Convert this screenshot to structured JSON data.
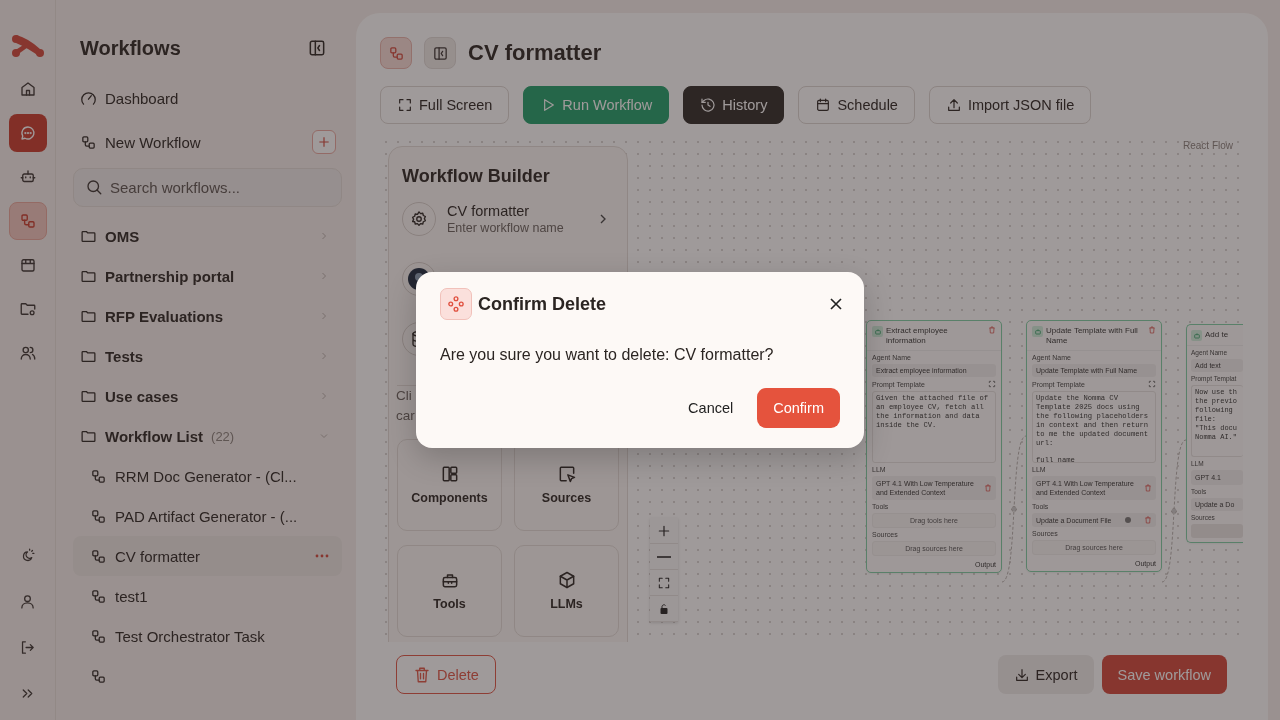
{
  "rail": [
    {
      "kind": "home",
      "selected": false,
      "accent": false
    },
    {
      "kind": "chat",
      "selected": false,
      "accent": true
    },
    {
      "kind": "bot",
      "selected": false,
      "accent": false
    },
    {
      "kind": "workflow",
      "selected": true,
      "accent": false
    },
    {
      "kind": "box",
      "selected": false,
      "accent": false
    },
    {
      "kind": "folder",
      "selected": false,
      "accent": false
    },
    {
      "kind": "users",
      "selected": false,
      "accent": false
    }
  ],
  "rail_bottom": [
    {
      "kind": "theme"
    },
    {
      "kind": "user"
    },
    {
      "kind": "logout"
    },
    {
      "kind": "expand"
    }
  ],
  "sidebar": {
    "title": "Workflows",
    "dashboard": "Dashboard",
    "new_workflow": "New Workflow",
    "search": {
      "placeholder": "Search workflows..."
    },
    "folders": [
      {
        "name": "OMS",
        "expanded": false
      },
      {
        "name": "Partnership portal",
        "expanded": false
      },
      {
        "name": "RFP Evaluations",
        "expanded": false
      },
      {
        "name": "Tests",
        "expanded": false
      },
      {
        "name": "Use cases",
        "expanded": false
      },
      {
        "name": "Workflow List",
        "count": "(22)",
        "expanded": true
      }
    ],
    "workflows": [
      {
        "name": "RRM Doc Generator - (Cl...",
        "selected": false
      },
      {
        "name": "PAD Artifact Generator - (...",
        "selected": false
      },
      {
        "name": "CV formatter",
        "selected": true
      },
      {
        "name": "test1",
        "selected": false
      },
      {
        "name": "Test Orchestrator Task",
        "selected": false
      },
      {
        "selected": false
      }
    ]
  },
  "main": {
    "title": "CV formatter",
    "toolbar": [
      {
        "kind": "fullscreen",
        "label": "Full Screen"
      },
      {
        "kind": "run",
        "label": "Run Workflow"
      },
      {
        "kind": "history",
        "label": "History"
      },
      {
        "kind": "schedule",
        "label": "Schedule"
      },
      {
        "kind": "import",
        "label": "Import JSON file"
      }
    ],
    "attribution": "React Flow",
    "builder": {
      "title": "Workflow Builder",
      "items": [
        {
          "kind": "settings",
          "title": "CV formatter",
          "subtitle": "Enter workflow name"
        },
        {
          "kind": "agent"
        },
        {
          "kind": "data"
        }
      ],
      "hint": [
        "Cli",
        "car"
      ],
      "tiles": [
        {
          "kind": "components",
          "label": "Components"
        },
        {
          "kind": "sources",
          "label": "Sources"
        },
        {
          "kind": "tools",
          "label": "Tools"
        },
        {
          "kind": "llms",
          "label": "LLMs"
        }
      ]
    },
    "nodes": [
      {
        "title": "Extract employee information",
        "cut": false,
        "agent_label": "Agent Name",
        "agent_name": "Extract employee information",
        "prompt_label": "Prompt Template",
        "prompt": [
          "Given the attached file of an employee CV, fetch all the information and data inside the CV."
        ],
        "llm_label": "LLM",
        "llm": "GPT 4.1 With Low Temperature and Extended Context",
        "tools_label": "Tools",
        "tools": {
          "kind": "placeholder",
          "text": "Drag tools here"
        },
        "sources_label": "Sources",
        "sources": "Drag sources here",
        "output": "Output"
      },
      {
        "title": "Update Template with Full Name",
        "cut": false,
        "agent_label": "Agent Name",
        "agent_name": "Update Template with Full Name",
        "prompt_label": "Prompt Template",
        "prompt": [
          "Update the Nomma CV Template 2025 docs using the following placeholders in context and then return to me the updated document url:",
          "full_name"
        ],
        "llm_label": "LLM",
        "llm": "GPT 4.1 With Low Temperature and Extended Context",
        "tools_label": "Tools",
        "tools": {
          "kind": "item",
          "text": "Update a Document File"
        },
        "sources_label": "Sources",
        "sources": "Drag sources here",
        "output": "Output"
      },
      {
        "title": "Add te",
        "cut": true,
        "agent_label": "Agent Name",
        "agent_name": "Add text",
        "prompt_label": "Prompt Templat",
        "prompt": [
          "Now use th",
          "the previo",
          "following",
          "file:",
          "\"This docu",
          "Nomma AI.\""
        ],
        "llm_label": "LLM",
        "llm": "GPT 4.1",
        "tools_label": "Tools",
        "tools": {
          "kind": "item",
          "text": "Update a Do"
        },
        "sources_label": "Sources"
      }
    ],
    "delete": "Delete",
    "export": "Export",
    "save": "Save workflow"
  },
  "dialog": {
    "title": "Confirm Delete",
    "message": "Are you sure you want to delete: CV formatter?",
    "cancel": "Cancel",
    "confirm": "Confirm"
  }
}
